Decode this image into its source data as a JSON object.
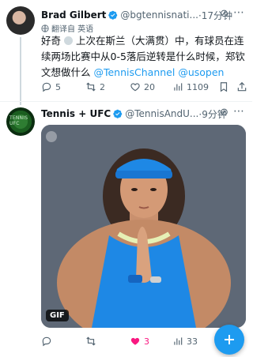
{
  "tweet1": {
    "name": "Brad Gilbert",
    "handle": "@bgtennisnati...",
    "time": "·17分钟",
    "translate_label": "翻译自 英语",
    "text_before": "好奇 ",
    "text_main": " 上次在斯兰（大满贯）中，有球员在连续两场比赛中从0-5落后逆转是什么时候，郑钦文想做什么 ",
    "link1": "@TennisChannel",
    "link2": "@usopen",
    "replies": "5",
    "retweets": "2",
    "likes": "20",
    "views": "1109"
  },
  "tweet2": {
    "name": "Tennis + UFC",
    "handle": "@TennisAndU...",
    "time": "·9分钟",
    "avatar_text": "TENNIS UFC",
    "gif_label": "GIF",
    "replies": "",
    "retweets": "",
    "likes": "3",
    "views": "33"
  },
  "icons": {
    "verified": "verified-badge-icon",
    "grok": "grok-icon",
    "more": "more-icon",
    "translate": "globe-icon",
    "reply": "reply-icon",
    "retweet": "retweet-icon",
    "like": "heart-icon",
    "views": "views-icon",
    "compose": "plus-icon"
  },
  "colors": {
    "accent": "#1d9bf0",
    "like_active": "#f91880",
    "muted": "#536471"
  }
}
